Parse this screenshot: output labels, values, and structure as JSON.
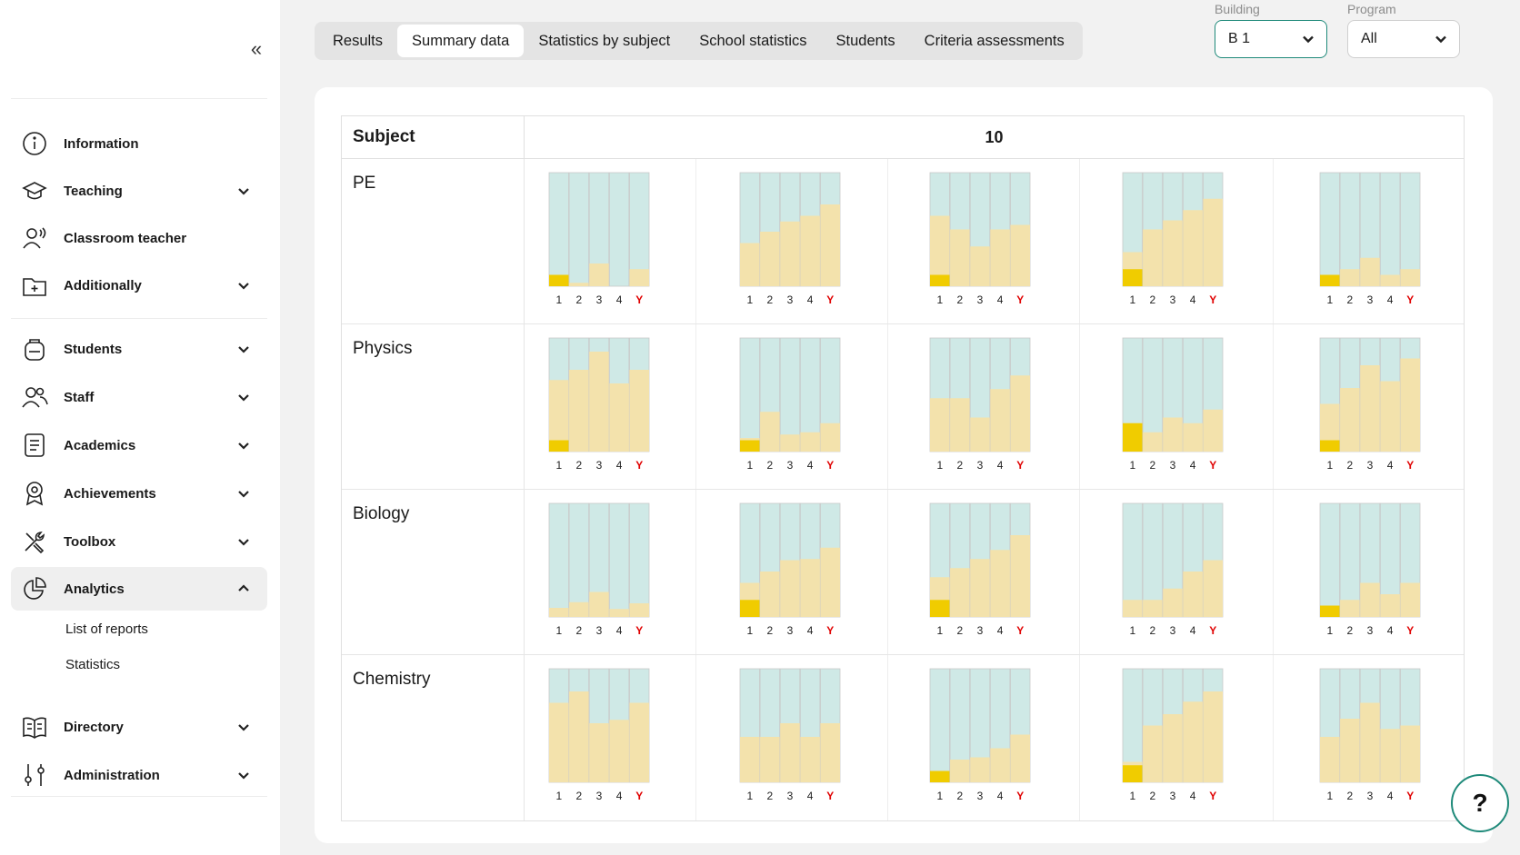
{
  "sidebar": {
    "nav": [
      {
        "label": "Information",
        "icon": "info-icon",
        "chevron": false
      },
      {
        "label": "Teaching",
        "icon": "graduation-cap-icon",
        "chevron": true
      },
      {
        "label": "Classroom teacher",
        "icon": "teacher-icon",
        "chevron": false
      },
      {
        "label": "Additionally",
        "icon": "folder-plus-icon",
        "chevron": true
      },
      {
        "label": "Students",
        "icon": "backpack-icon",
        "chevron": true
      },
      {
        "label": "Staff",
        "icon": "users-icon",
        "chevron": true
      },
      {
        "label": "Academics",
        "icon": "document-icon",
        "chevron": true
      },
      {
        "label": "Achievements",
        "icon": "award-icon",
        "chevron": true
      },
      {
        "label": "Toolbox",
        "icon": "tools-icon",
        "chevron": true
      },
      {
        "label": "Analytics",
        "icon": "pie-chart-icon",
        "chevron": true,
        "expanded": true
      },
      {
        "label": "Directory",
        "icon": "book-icon",
        "chevron": true
      },
      {
        "label": "Administration",
        "icon": "sliders-icon",
        "chevron": true
      }
    ],
    "analytics_sub": [
      "List of reports",
      "Statistics"
    ]
  },
  "tabs": [
    "Results",
    "Summary data",
    "Statistics by subject",
    "School statistics",
    "Students",
    "Criteria assessments"
  ],
  "active_tab": 1,
  "filters": {
    "building": {
      "label": "Building",
      "value": "B 1"
    },
    "program": {
      "label": "Program",
      "value": "All"
    }
  },
  "table": {
    "subject_header": "Subject",
    "grade_header": "10",
    "x_labels": [
      "1",
      "2",
      "3",
      "4",
      "Y"
    ],
    "colors": {
      "track": "#cfe9e6",
      "fill": "#f3e2ac",
      "highlight": "#f0cc00",
      "y_label": "#e00000"
    },
    "rows": [
      {
        "subject": "PE",
        "charts": [
          {
            "values": [
              0.1,
              0.03,
              0.2,
              0.0,
              0.15
            ],
            "highlight": 0.1
          },
          {
            "values": [
              0.38,
              0.48,
              0.57,
              0.62,
              0.72
            ],
            "highlight": 0
          },
          {
            "values": [
              0.62,
              0.5,
              0.35,
              0.5,
              0.54
            ],
            "highlight": 0.1
          },
          {
            "values": [
              0.3,
              0.5,
              0.58,
              0.67,
              0.77
            ],
            "highlight": 0.15
          },
          {
            "values": [
              0.1,
              0.15,
              0.25,
              0.1,
              0.15
            ],
            "highlight": 0.1
          }
        ]
      },
      {
        "subject": "Physics",
        "charts": [
          {
            "values": [
              0.63,
              0.72,
              0.88,
              0.6,
              0.72
            ],
            "highlight": 0.1
          },
          {
            "values": [
              0.12,
              0.35,
              0.15,
              0.17,
              0.25
            ],
            "highlight": 0.1
          },
          {
            "values": [
              0.47,
              0.47,
              0.3,
              0.55,
              0.67
            ],
            "highlight": 0
          },
          {
            "values": [
              0.25,
              0.17,
              0.3,
              0.25,
              0.37
            ],
            "highlight": 0.25
          },
          {
            "values": [
              0.42,
              0.56,
              0.76,
              0.62,
              0.82
            ],
            "highlight": 0.1
          }
        ]
      },
      {
        "subject": "Biology",
        "charts": [
          {
            "values": [
              0.08,
              0.13,
              0.22,
              0.07,
              0.12
            ],
            "highlight": 0
          },
          {
            "values": [
              0.3,
              0.4,
              0.5,
              0.51,
              0.61
            ],
            "highlight": 0.15
          },
          {
            "values": [
              0.35,
              0.43,
              0.51,
              0.59,
              0.72
            ],
            "highlight": 0.15
          },
          {
            "values": [
              0.15,
              0.15,
              0.25,
              0.4,
              0.5
            ],
            "highlight": 0
          },
          {
            "values": [
              0.1,
              0.15,
              0.3,
              0.2,
              0.3
            ],
            "highlight": 0.1
          }
        ]
      },
      {
        "subject": "Chemistry",
        "charts": [
          {
            "values": [
              0.7,
              0.8,
              0.52,
              0.55,
              0.7
            ],
            "highlight": 0
          },
          {
            "values": [
              0.4,
              0.4,
              0.52,
              0.4,
              0.52
            ],
            "highlight": 0
          },
          {
            "values": [
              0.1,
              0.2,
              0.22,
              0.3,
              0.42
            ],
            "highlight": 0.1
          },
          {
            "values": [
              0.18,
              0.5,
              0.6,
              0.71,
              0.8
            ],
            "highlight": 0.15
          },
          {
            "values": [
              0.4,
              0.56,
              0.7,
              0.47,
              0.5
            ],
            "highlight": 0
          }
        ]
      }
    ]
  },
  "help": {
    "label": "?"
  }
}
